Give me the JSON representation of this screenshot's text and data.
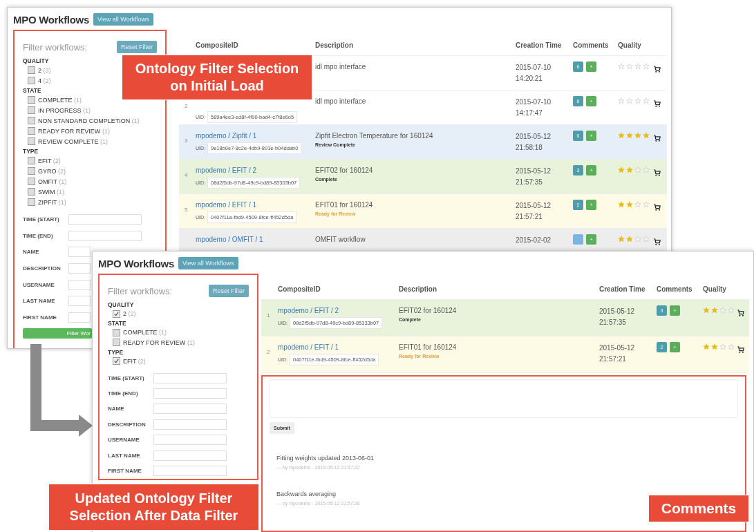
{
  "initial_view": {
    "title": "MPO Workflows",
    "view_all_button": "View all Workflows",
    "filter": {
      "title": "Filter workflows:",
      "reset_button": "Reset Filter",
      "groups": [
        {
          "label": "QUALITY",
          "options": [
            {
              "label": "2",
              "count": "(3)",
              "checked": false
            },
            {
              "label": "4",
              "count": "(2)",
              "checked": false
            }
          ]
        },
        {
          "label": "STATE",
          "options": [
            {
              "label": "COMPLETE",
              "count": "(1)",
              "checked": false
            },
            {
              "label": "IN PROGRESS",
              "count": "(1)",
              "checked": false
            },
            {
              "label": "NON STANDARD COMPLETION",
              "count": "(1)",
              "checked": false
            },
            {
              "label": "READY FOR REVIEW",
              "count": "(1)",
              "checked": false
            },
            {
              "label": "REVIEW COMPLETE",
              "count": "(1)",
              "checked": false
            }
          ]
        },
        {
          "label": "TYPE",
          "options": [
            {
              "label": "EFIT",
              "count": "(2)",
              "checked": false
            },
            {
              "label": "GYRO",
              "count": "(2)",
              "checked": false
            },
            {
              "label": "OMFIT",
              "count": "(1)",
              "checked": false
            },
            {
              "label": "SWIM",
              "count": "(1)",
              "checked": false
            },
            {
              "label": "ZIPFIT",
              "count": "(1)",
              "checked": false
            }
          ]
        }
      ],
      "fields": [
        "TIME (START)",
        "TIME (END)",
        "NAME",
        "DESCRIPTION",
        "USERNAME",
        "LAST NAME",
        "FIRST NAME"
      ],
      "submit_button": "Filter Wor"
    },
    "table": {
      "columns": [
        "CompositeID",
        "Description",
        "Creation Time",
        "Comments",
        "Quality"
      ],
      "rows": [
        {
          "kind": "plain",
          "description": "idl mpo interface",
          "date": "2015-07-10",
          "time": "14:20:21",
          "comment_count": "6",
          "add": "+",
          "stars": 0
        },
        {
          "kind": "plain",
          "index": "2",
          "uid_label": "UID:",
          "uid": "589a4ee3-ed8f-4f90-bad4-c7f8e6o5",
          "description": "idl mpo interface",
          "date": "2015-07-10",
          "time": "14:17:47",
          "comment_count": "6",
          "add": "+",
          "stars": 0
        },
        {
          "kind": "reviewed",
          "index": "3",
          "composite_id": "mpodemo / Zipfit / 1",
          "uid_label": "UID:",
          "uid": "9e18b0e7-8c2e-4db9-891e-b04ddab0",
          "description": "Zipfit Electron Temperature for 160124",
          "status": "Review Complete",
          "date": "2015-05-12",
          "time": "21:58:18",
          "comment_count": "6",
          "add": "+",
          "stars": 4
        },
        {
          "kind": "complete",
          "index": "4",
          "composite_id": "mpodemo / EFIT / 2",
          "uid_label": "UID:",
          "uid": "08d2f5db-97d8-49c9-bd89-85303b07",
          "description": "EFIT02 for 160124",
          "status": "Complete",
          "date": "2015-05-12",
          "time": "21:57:35",
          "comment_count": "3",
          "add": "+",
          "stars": 2
        },
        {
          "kind": "ready",
          "index": "5",
          "composite_id": "mpodemo / EFIT / 1",
          "uid_label": "UID:",
          "uid": "0407f11a-fbd9-4509-8fce-ff452d5da",
          "description": "EFIT01 for 160124",
          "status": "Ready for Review",
          "date": "2015-05-12",
          "time": "21:57:21",
          "comment_count": "2",
          "add": "+",
          "stars": 2
        },
        {
          "kind": "other",
          "composite_id": "mpodemo / OMFIT / 1",
          "description": "OMFIT workflow",
          "date": "2015-02-02",
          "add": "+",
          "stars": 2
        }
      ]
    }
  },
  "filtered_view": {
    "title": "MPO Workflows",
    "view_all_button": "View all Workflows",
    "filter": {
      "title": "Filter workflows:",
      "reset_button": "Reset Filter",
      "groups": [
        {
          "label": "QUALITY",
          "options": [
            {
              "label": "2",
              "count": "(2)",
              "checked": true
            }
          ]
        },
        {
          "label": "STATE",
          "options": [
            {
              "label": "COMPLETE",
              "count": "(1)",
              "checked": false
            },
            {
              "label": "READY FOR REVIEW",
              "count": "(1)",
              "checked": false
            }
          ]
        },
        {
          "label": "TYPE",
          "options": [
            {
              "label": "EFIT",
              "count": "(2)",
              "checked": true
            }
          ]
        }
      ],
      "fields": [
        "TIME (START)",
        "TIME (END)",
        "NAME",
        "DESCRIPTION",
        "USERNAME",
        "LAST NAME",
        "FIRST NAME"
      ]
    },
    "table": {
      "columns": [
        "CompositeID",
        "Description",
        "Creation Time",
        "Comments",
        "Quality"
      ],
      "rows": [
        {
          "kind": "complete",
          "index": "1",
          "composite_id": "mpodemo / EFIT / 2",
          "uid_label": "UID:",
          "uid": "08d2f5db-97d8-49c9-bd89-85333b07",
          "description": "EFIT02 for 160124",
          "status": "Complete",
          "date": "2015-05-12",
          "time": "21:57:35",
          "comment_count": "3",
          "add": "+",
          "stars": 2
        },
        {
          "kind": "ready",
          "index": "2",
          "composite_id": "mpodemo / EFIT / 1",
          "uid_label": "UID:",
          "uid": "0407f11e-fbd9-4509-8fce-ff452d5da",
          "description": "EFIT01 for 160124",
          "status": "Ready for Review",
          "date": "2015-05-12",
          "time": "21:57:21",
          "comment_count": "2",
          "add": "+",
          "stars": 2
        }
      ]
    },
    "comments": {
      "submit_button": "Submit",
      "items": [
        {
          "text": "Fitting weights updated 2013-06-01",
          "meta": "— by mpodemo - 2015-05-12 21:57:22"
        },
        {
          "text": "Backwards averaging",
          "meta": "— by mpodemo - 2015-05-12 21:57:26"
        }
      ]
    }
  },
  "callouts": [
    {
      "kind": "initial",
      "text": "Ontology Filter Selection on Initial Load"
    },
    {
      "kind": "updated",
      "text": "Updated Ontology Filter Selection After Data Filter"
    },
    {
      "kind": "comments",
      "text": "Comments"
    }
  ]
}
